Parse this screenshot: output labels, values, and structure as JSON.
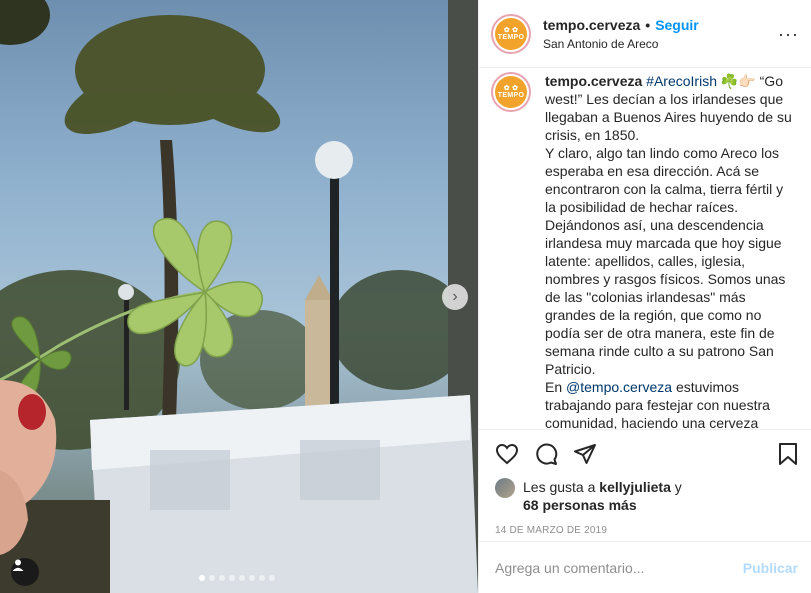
{
  "header": {
    "username": "tempo.cerveza",
    "separator": "•",
    "follow_label": "Seguir",
    "location": "San Antonio de Areco",
    "more_label": "···"
  },
  "avatar": {
    "text": "TEMPO"
  },
  "caption": {
    "username": "tempo.cerveza",
    "hashtag": "#ArecoIrish",
    "emoji": "☘️👉🏻",
    "p1": "“Go west!” Les decían a los irlandeses que llegaban a Buenos Aires huyendo de su crisis, en 1850.",
    "p2": "Y claro, algo tan lindo como Areco los esperaba en esa dirección. Acá se encontraron con la calma, tierra fértil y la posibilidad de hechar raíces.",
    "p3": "Dejándonos así, una descendencia irlandesa muy marcada que hoy sigue latente: apellidos, calles, iglesia, nombres y rasgos físicos. Somos unas de las \"colonias irlandesas\" más grandes de la región, que como no podía ser de otra manera, este fin de semana rinde culto a su patrono San Patricio.",
    "p4_prefix": "En",
    "p4_mention": "@tempo.cerveza",
    "p4_rest": "estuvimos trabajando para festejar con nuestra comunidad, haciendo una cerveza"
  },
  "likes": {
    "prefix": "Les gusta a",
    "user": "kellyjulieta",
    "conj": "y",
    "count_text": "68 personas más"
  },
  "date": "14 DE MARZO DE 2019",
  "comment": {
    "placeholder": "Agrega un comentario...",
    "publish_label": "Publicar"
  },
  "carousel": {
    "total": 8,
    "active": 0
  },
  "colors": {
    "accent": "#0095f6",
    "publish_disabled": "#b3dbff",
    "brand_orange": "#f2a32c"
  }
}
